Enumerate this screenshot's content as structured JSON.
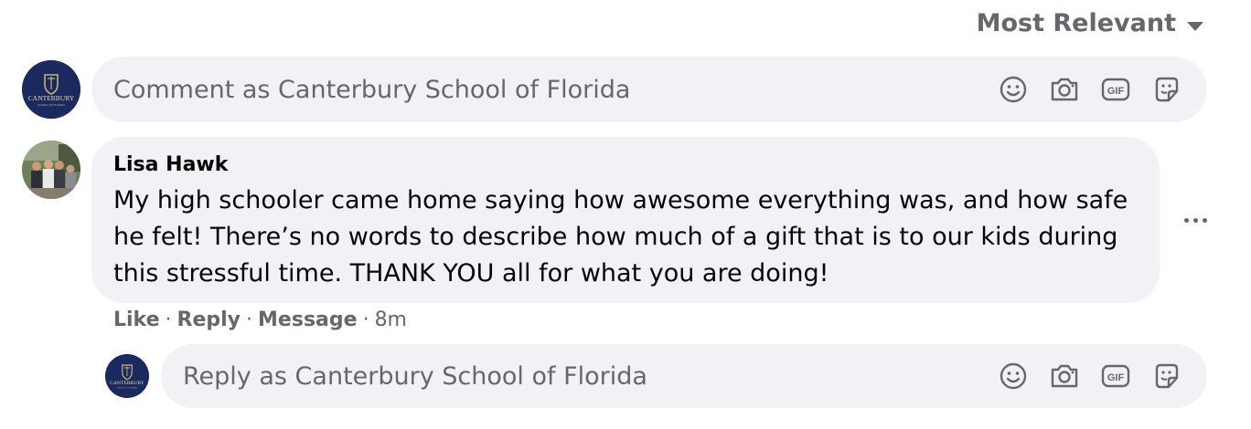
{
  "sort": {
    "label": "Most Relevant"
  },
  "composer": {
    "placeholder": "Comment as Canterbury School of Florida"
  },
  "comment": {
    "author": "Lisa Hawk",
    "text": "My high schooler came home saying how awesome everything was, and how safe he felt! There’s no words to describe how much of a gift that is to our kids during this stressful time. THANK YOU all for what you are doing!",
    "actions": {
      "like": "Like",
      "reply": "Reply",
      "message": "Message",
      "time": "8m",
      "separator": "·"
    }
  },
  "reply_composer": {
    "placeholder": "Reply as Canterbury School of Florida"
  },
  "school_logo_text": "CANTERBURY",
  "tool_icons": [
    "emoji-icon",
    "camera-icon",
    "gif-icon",
    "sticker-icon"
  ]
}
